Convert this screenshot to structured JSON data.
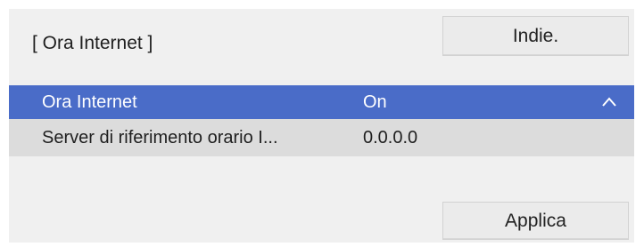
{
  "header": {
    "title": "[ Ora Internet ]",
    "back_label": "Indie."
  },
  "rows": [
    {
      "label": "Ora Internet",
      "value": "On",
      "selected": true,
      "icon": "chevron-up-icon"
    },
    {
      "label": "Server di riferimento orario I...",
      "value": "0.0.0.0",
      "selected": false
    }
  ],
  "footer": {
    "apply_label": "Applica"
  },
  "colors": {
    "panel_bg": "#f0f0f0",
    "selected_row_bg": "#4a6cc8",
    "row_bg": "#dcdcdc",
    "button_bg": "#ebebeb"
  }
}
